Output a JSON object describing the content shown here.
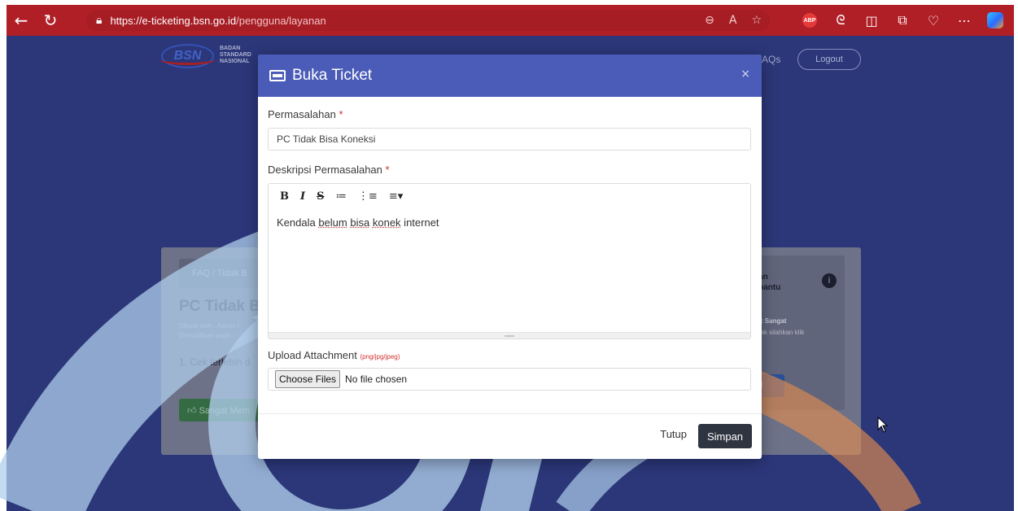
{
  "browser": {
    "url_host": "https://e-ticketing.bsn.go.id",
    "url_path": "/pengguna/layanan"
  },
  "site": {
    "logo_text": "BSN",
    "logo_caption_1": "BADAN",
    "logo_caption_2": "STANDARD",
    "logo_caption_3": "NASIONAL",
    "nav_faq": "AQs",
    "logout_label": "Logout"
  },
  "background_card": {
    "breadcrumb": "FAQ / Tidak B",
    "title": "PC Tidak B",
    "meta_created": "Dibuat oleh : Admin I",
    "meta_modified": "Dimodifikasi pada : -",
    "step": "1. Cek terlebih d",
    "like_label": "Sangat Mem",
    "side_heading_1": "oan",
    "side_heading_2": "nbantu",
    "side_text_1_prefix": "klik ",
    "side_text_1_bold": "Sangat",
    "side_text_2": "tidak silahkan klik",
    "side_button": "et"
  },
  "modal": {
    "title": "Buka Ticket",
    "close_symbol": "×",
    "field_problem_label": "Permasalahan",
    "field_problem_value": "PC Tidak Bisa Koneksi",
    "field_desc_label": "Deskripsi Permasalahan",
    "required_mark": "*",
    "editor_toolbar": [
      "B",
      "I",
      "S",
      "≔",
      "⋮≡",
      "≡▾"
    ],
    "editor_text_1": "Kendala ",
    "editor_word_belum": "belum",
    "editor_word_bisa": "bisa",
    "editor_word_konek": "konek",
    "editor_text_2": " internet",
    "upload_label": "Upload Attachment",
    "upload_note": "(png/jpg/jpeg)",
    "choose_files": "Choose Files",
    "no_file": "No file chosen",
    "cancel_label": "Tutup",
    "save_label": "Simpan"
  },
  "colors": {
    "browser_bar": "#b01f26",
    "page_backdrop": "#2f3c84",
    "modal_header": "#4a5cb7",
    "save_button": "#2e3440",
    "required": "#d02a2a"
  }
}
